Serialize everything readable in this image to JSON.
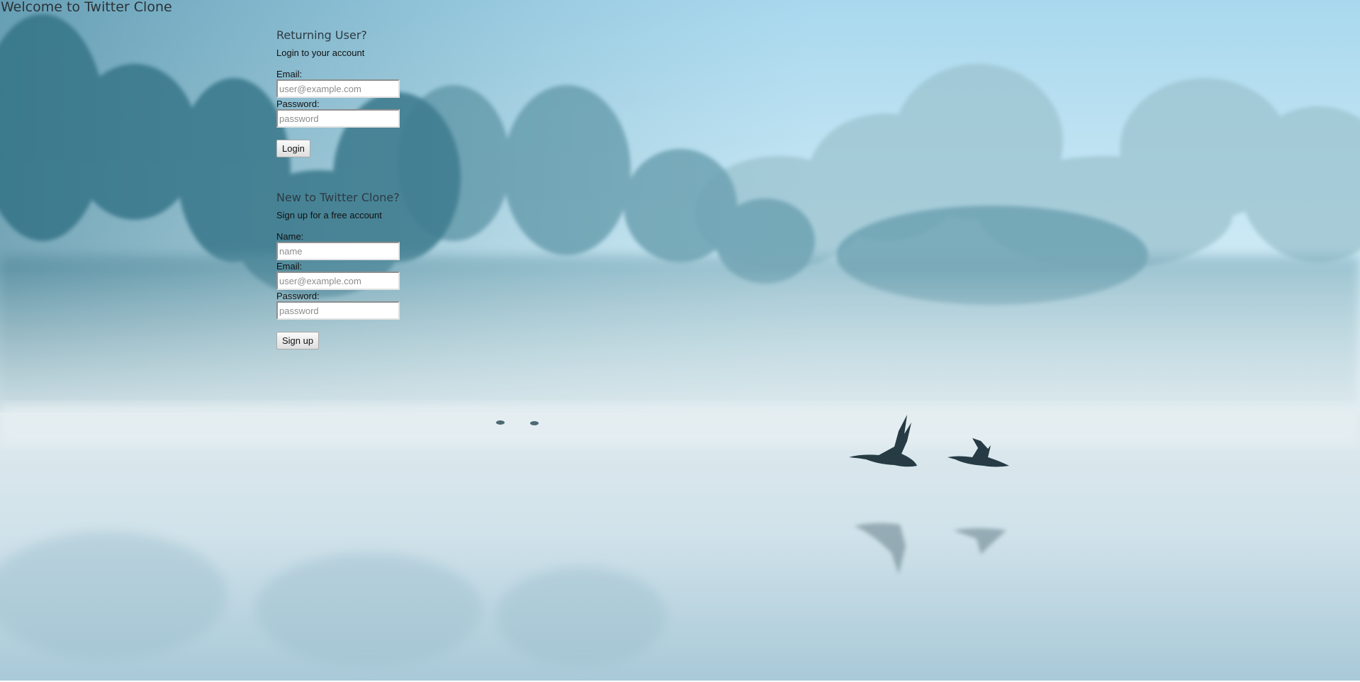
{
  "page": {
    "title": "Welcome to Twitter Clone"
  },
  "login": {
    "heading": "Returning User?",
    "subtitle": "Login to your account",
    "email_label": "Email:",
    "email_placeholder": "user@example.com",
    "email_value": "",
    "password_label": "Password:",
    "password_placeholder": "password",
    "password_value": "",
    "button_label": "Login"
  },
  "signup": {
    "heading": "New to Twitter Clone?",
    "subtitle": "Sign up for a free account",
    "name_label": "Name:",
    "name_placeholder": "name",
    "name_value": "",
    "email_label": "Email:",
    "email_placeholder": "user@example.com",
    "email_value": "",
    "password_label": "Password:",
    "password_placeholder": "password",
    "password_value": "",
    "button_label": "Sign up"
  },
  "background": {
    "description_icon": "misty-lake-with-geese-image",
    "sky_color": "#bfe3f3",
    "water_color": "#c7dde7",
    "tree_color": "#5e93a4"
  }
}
